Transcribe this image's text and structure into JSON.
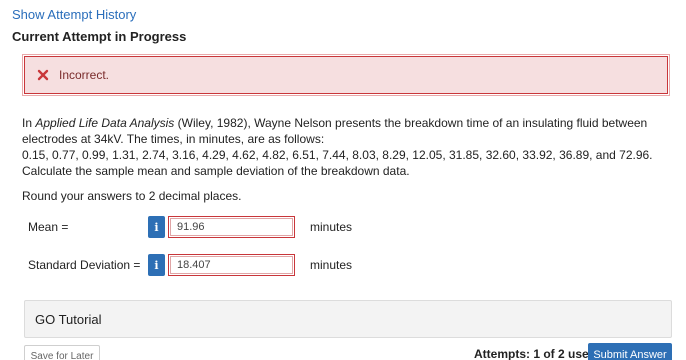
{
  "header": {
    "history_link": "Show Attempt History",
    "attempt_title": "Current Attempt in Progress"
  },
  "alert": {
    "icon": "x-mark-icon",
    "text": "Incorrect.",
    "color": "#c9363a"
  },
  "question": {
    "intro_prefix": "In ",
    "book_title": "Applied Life Data Analysis",
    "intro_suffix": " (Wiley, 1982), Wayne Nelson presents the breakdown time of an insulating fluid between electrodes at 34kV. The times, in minutes, are as follows:",
    "data_line": "0.15, 0.77, 0.99, 1.31, 2.74, 3.16, 4.29, 4.62, 4.82, 6.51, 7.44, 8.03, 8.29, 12.05, 31.85, 32.60, 33.92, 36.89, and 72.96.",
    "instruction": "Calculate the sample mean and sample deviation of the breakdown data.",
    "rounding": "Round your answers to 2 decimal places."
  },
  "answers": [
    {
      "label": "Mean =",
      "info_glyph": "i",
      "value": "91.96",
      "unit": "minutes"
    },
    {
      "label": "Standard Deviation =",
      "info_glyph": "i",
      "value": "18.407",
      "unit": "minutes"
    }
  ],
  "tutorial": {
    "label": "GO Tutorial"
  },
  "footer": {
    "save_label": "Save for Later",
    "attempts_text": "Attempts: 1 of 2 used",
    "submit_label": "Submit Answer"
  },
  "colors": {
    "accent": "#2d6fb5",
    "error": "#c9363a",
    "error_bg": "#f6dfe0"
  }
}
